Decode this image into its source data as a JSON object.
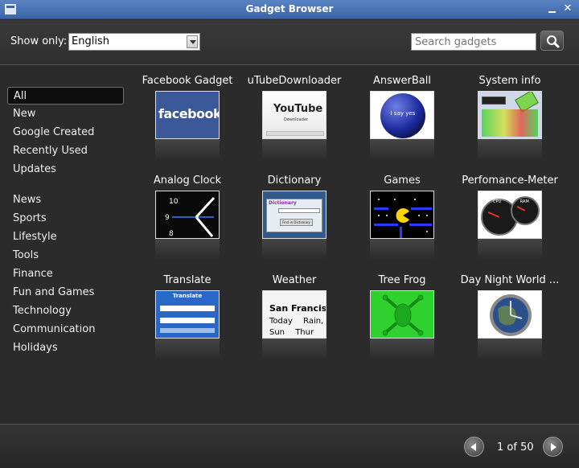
{
  "window": {
    "title": "Gadget Browser"
  },
  "topbar": {
    "show_only_label": "Show only:",
    "language": "English",
    "search_placeholder": "Search gadgets"
  },
  "sidebar": {
    "group1": [
      "All",
      "New",
      "Google Created",
      "Recently Used",
      "Updates"
    ],
    "group2": [
      "News",
      "Sports",
      "Lifestyle",
      "Tools",
      "Finance",
      "Fun and Games",
      "Technology",
      "Communication",
      "Holidays"
    ]
  },
  "gadgets": [
    {
      "name": "Facebook Gadget",
      "thumb_text": "facebook"
    },
    {
      "name": "uTubeDownloader",
      "thumb_text": "YouTube",
      "thumb_sub": "Downloader"
    },
    {
      "name": "AnswerBall",
      "thumb_text": "I say yes"
    },
    {
      "name": "System info",
      "thumb_text": ""
    },
    {
      "name": "Analog Clock",
      "thumb_text": "10 9 8"
    },
    {
      "name": "Dictionary",
      "thumb_text": "Dictionary",
      "thumb_sub": "Find in Dictionary"
    },
    {
      "name": "Games",
      "thumb_text": ""
    },
    {
      "name": "Perfomance-Meter",
      "thumb_text": "CPU RAM"
    },
    {
      "name": "Translate",
      "thumb_text": "Translate"
    },
    {
      "name": "Weather",
      "thumb_text": "San Francisco",
      "thumb_sub": "Today Rain, Sun Thur"
    },
    {
      "name": "Tree Frog",
      "thumb_text": ""
    },
    {
      "name": "Day Night World ...",
      "thumb_text": ""
    }
  ],
  "pagination": {
    "text": "1 of 50"
  }
}
